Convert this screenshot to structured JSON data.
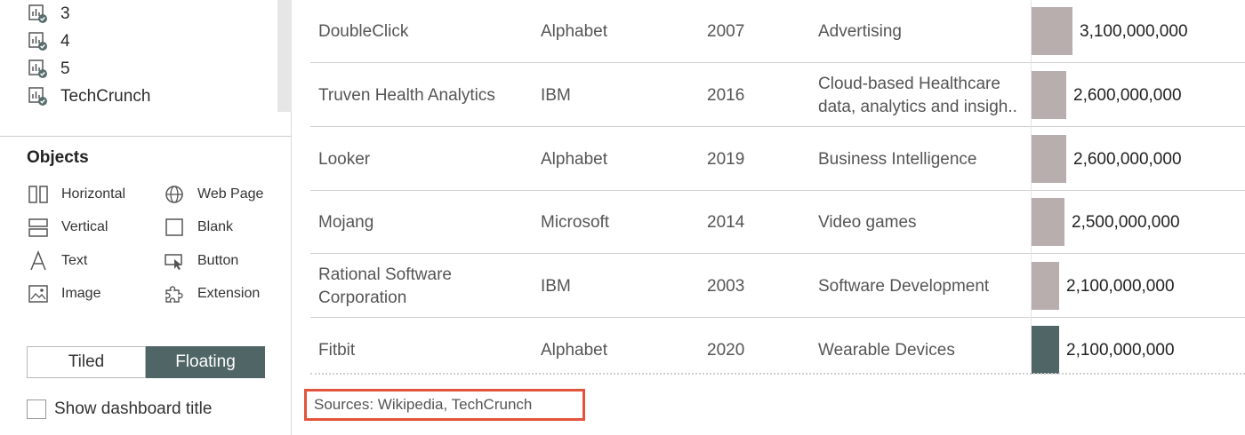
{
  "sidebar": {
    "sheets": [
      {
        "label": "3"
      },
      {
        "label": "4"
      },
      {
        "label": "5"
      },
      {
        "label": "TechCrunch"
      }
    ],
    "objects_title": "Objects",
    "objects": [
      {
        "label": "Horizontal",
        "icon": "horizontal-container-icon"
      },
      {
        "label": "Web Page",
        "icon": "globe-icon"
      },
      {
        "label": "Vertical",
        "icon": "vertical-container-icon"
      },
      {
        "label": "Blank",
        "icon": "blank-square-icon"
      },
      {
        "label": "Text",
        "icon": "text-icon"
      },
      {
        "label": "Button",
        "icon": "button-cursor-icon"
      },
      {
        "label": "Image",
        "icon": "image-icon"
      },
      {
        "label": "Extension",
        "icon": "puzzle-icon"
      }
    ],
    "layout_toggle": {
      "tiled": "Tiled",
      "floating": "Floating",
      "selected": "Floating"
    },
    "show_title_label": "Show dashboard title",
    "show_title_checked": false
  },
  "table": {
    "rows": [
      {
        "company": "DoubleClick",
        "acquirer": "Alphabet",
        "year": "2007",
        "industry": "Advertising",
        "value_label": "3,100,000,000",
        "value": 3100000000,
        "highlight": false
      },
      {
        "company": "Truven Health Analytics",
        "acquirer": "IBM",
        "year": "2016",
        "industry_line1": "Cloud-based Healthcare",
        "industry_line2": "data, analytics and insigh..",
        "value_label": "2,600,000,000",
        "value": 2600000000,
        "highlight": false
      },
      {
        "company": "Looker",
        "acquirer": "Alphabet",
        "year": "2019",
        "industry": "Business Intelligence",
        "value_label": "2,600,000,000",
        "value": 2600000000,
        "highlight": false
      },
      {
        "company": "Mojang",
        "acquirer": "Microsoft",
        "year": "2014",
        "industry": "Video games",
        "value_label": "2,500,000,000",
        "value": 2500000000,
        "highlight": false
      },
      {
        "company_line1": "Rational Software",
        "company_line2": "Corporation",
        "acquirer": "IBM",
        "year": "2003",
        "industry": "Software Development",
        "value_label": "2,100,000,000",
        "value": 2100000000,
        "highlight": false
      },
      {
        "company": "Fitbit",
        "acquirer": "Alphabet",
        "year": "2020",
        "industry": "Wearable Devices",
        "value_label": "2,100,000,000",
        "value": 2100000000,
        "highlight": true
      }
    ]
  },
  "sources": "Sources: Wikipedia,  TechCrunch",
  "colors": {
    "bar": "#b8aeae",
    "bar_highlight": "#4f6566",
    "sources_border": "#e2543b",
    "floating_active": "#4f6566"
  }
}
